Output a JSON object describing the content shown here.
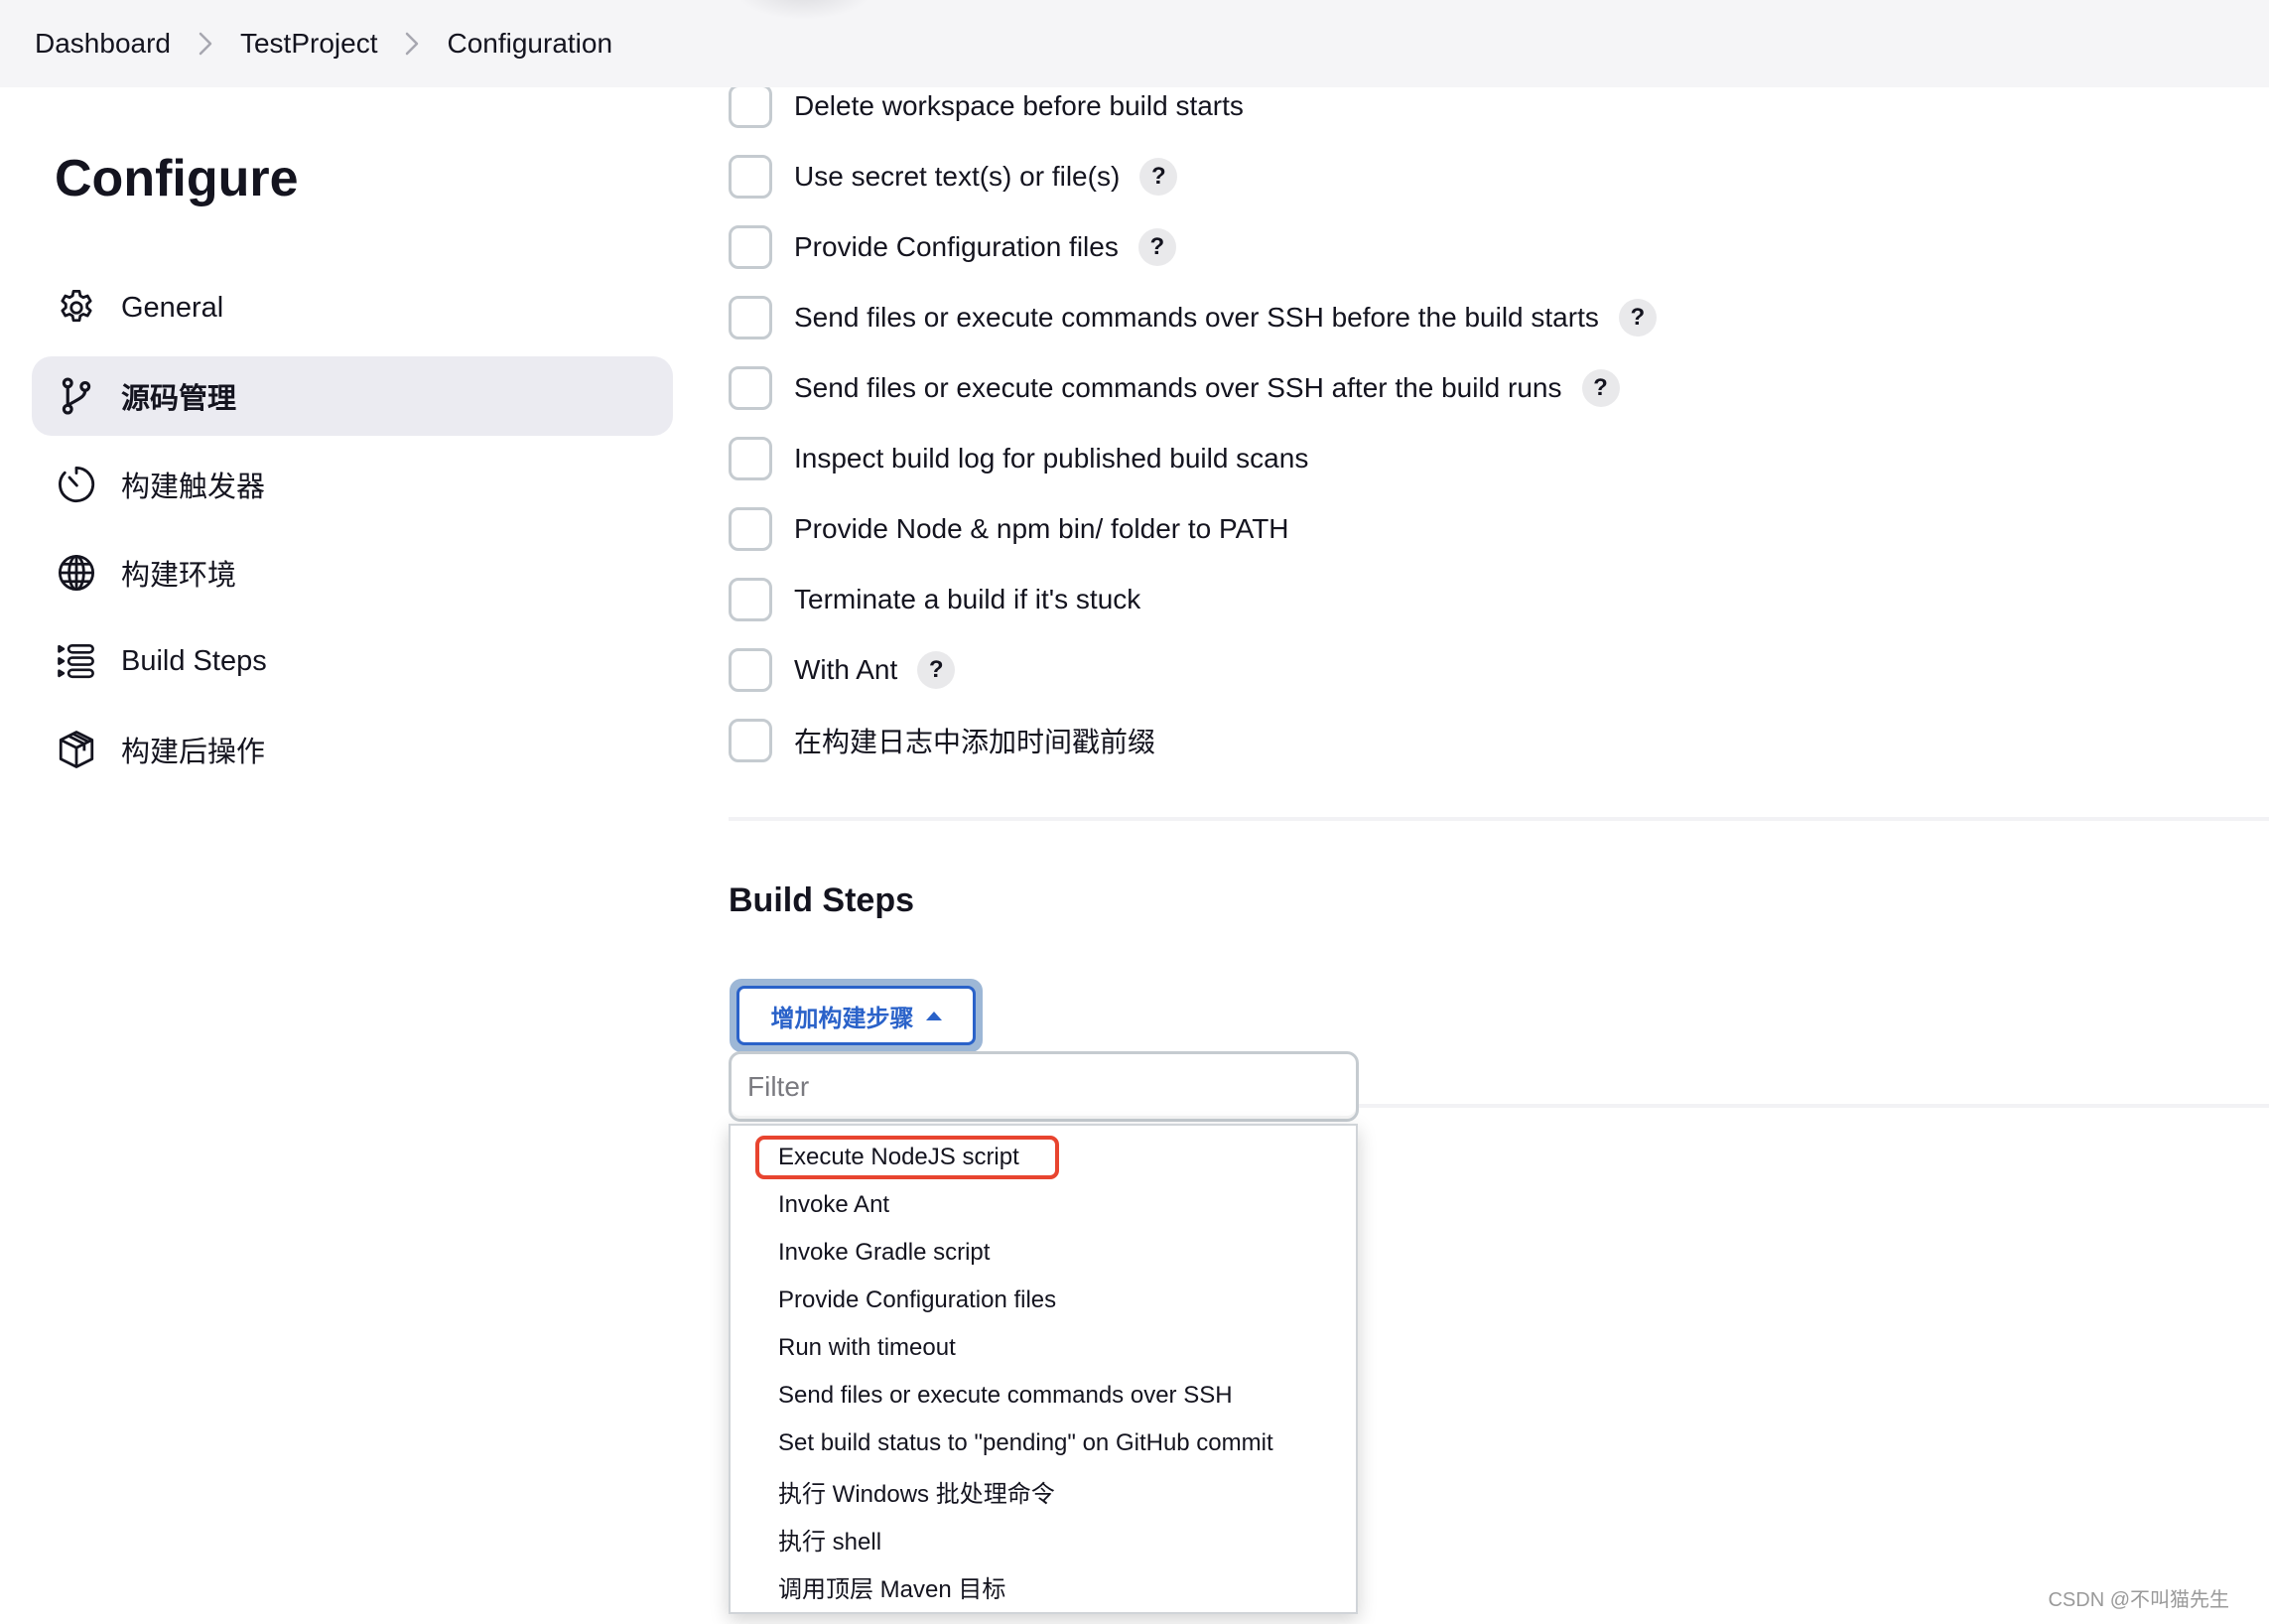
{
  "breadcrumb": [
    {
      "label": "Dashboard"
    },
    {
      "label": "TestProject"
    },
    {
      "label": "Configuration"
    }
  ],
  "sidebar": {
    "title": "Configure",
    "items": [
      {
        "label": "General",
        "icon": "gear-icon",
        "active": false
      },
      {
        "label": "源码管理",
        "icon": "git-branch-icon",
        "active": true
      },
      {
        "label": "构建触发器",
        "icon": "timer-icon",
        "active": false
      },
      {
        "label": "构建环境",
        "icon": "globe-icon",
        "active": false
      },
      {
        "label": "Build Steps",
        "icon": "list-steps-icon",
        "active": false
      },
      {
        "label": "构建后操作",
        "icon": "package-icon",
        "active": false
      }
    ]
  },
  "build_environment": {
    "options": [
      {
        "label": "Delete workspace before build starts",
        "checked": false,
        "help": false
      },
      {
        "label": "Use secret text(s) or file(s)",
        "checked": false,
        "help": true
      },
      {
        "label": "Provide Configuration files",
        "checked": false,
        "help": true
      },
      {
        "label": "Send files or execute commands over SSH before the build starts",
        "checked": false,
        "help": true
      },
      {
        "label": "Send files or execute commands over SSH after the build runs",
        "checked": false,
        "help": true
      },
      {
        "label": "Inspect build log for published build scans",
        "checked": false,
        "help": false
      },
      {
        "label": "Provide Node & npm bin/ folder to PATH",
        "checked": false,
        "help": false
      },
      {
        "label": "Terminate a build if it's stuck",
        "checked": false,
        "help": false
      },
      {
        "label": "With Ant",
        "checked": false,
        "help": true
      },
      {
        "label": "在构建日志中添加时间戳前缀",
        "checked": false,
        "help": false
      }
    ],
    "help_glyph": "?"
  },
  "build_steps": {
    "title": "Build Steps",
    "add_button_label": "增加构建步骤",
    "filter_placeholder": "Filter",
    "filter_value": "",
    "menu_items": [
      "Execute NodeJS script",
      "Invoke Ant",
      "Invoke Gradle script",
      "Provide Configuration files",
      "Run with timeout",
      "Send files or execute commands over SSH",
      "Set build status to \"pending\" on GitHub commit",
      "执行 Windows 批处理命令",
      "执行 shell",
      "调用顶层 Maven 目标"
    ],
    "highlighted_item": "Execute NodeJS script"
  },
  "colors": {
    "accent_blue": "#2a62c9",
    "highlight_red": "#e8442f",
    "active_nav_bg": "#ebebf1",
    "header_bg": "#f5f5f7"
  },
  "watermark": "CSDN @不叫猫先生"
}
